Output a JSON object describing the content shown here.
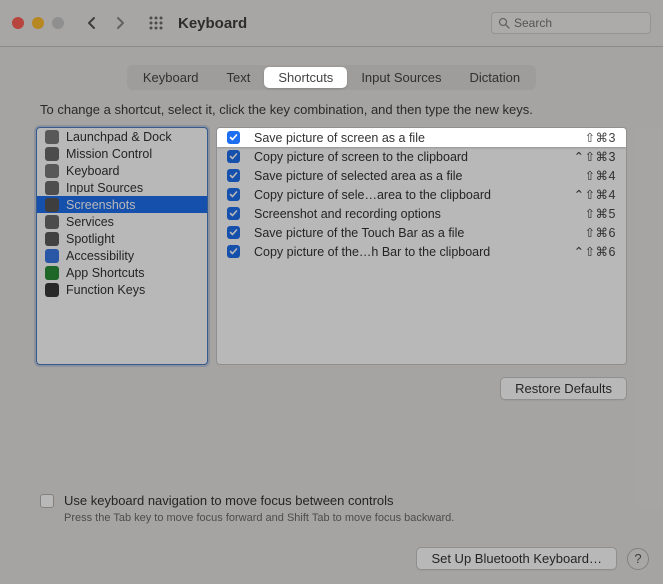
{
  "window": {
    "title": "Keyboard"
  },
  "search": {
    "placeholder": "Search"
  },
  "tabs": [
    {
      "label": "Keyboard"
    },
    {
      "label": "Text"
    },
    {
      "label": "Shortcuts",
      "active": true
    },
    {
      "label": "Input Sources"
    },
    {
      "label": "Dictation"
    }
  ],
  "instruction": "To change a shortcut, select it, click the key combination, and then type the new keys.",
  "categories": [
    {
      "label": "Launchpad & Dock"
    },
    {
      "label": "Mission Control"
    },
    {
      "label": "Keyboard"
    },
    {
      "label": "Input Sources"
    },
    {
      "label": "Screenshots",
      "selected": true
    },
    {
      "label": "Services"
    },
    {
      "label": "Spotlight"
    },
    {
      "label": "Accessibility"
    },
    {
      "label": "App Shortcuts"
    },
    {
      "label": "Function Keys"
    }
  ],
  "shortcuts": [
    {
      "label": "Save picture of screen as a file",
      "keys": "⇧⌘3",
      "selected": true
    },
    {
      "label": "Copy picture of screen to the clipboard",
      "keys": "⌃⇧⌘3"
    },
    {
      "label": "Save picture of selected area as a file",
      "keys": "⇧⌘4"
    },
    {
      "label": "Copy picture of sele…area to the clipboard",
      "keys": "⌃⇧⌘4"
    },
    {
      "label": "Screenshot and recording options",
      "keys": "⇧⌘5"
    },
    {
      "label": "Save picture of the Touch Bar as a file",
      "keys": "⇧⌘6"
    },
    {
      "label": "Copy picture of the…h Bar to the clipboard",
      "keys": "⌃⇧⌘6"
    }
  ],
  "buttons": {
    "restore": "Restore Defaults",
    "bluetooth": "Set Up Bluetooth Keyboard…"
  },
  "kbnav": {
    "label": "Use keyboard navigation to move focus between controls",
    "hint": "Press the Tab key to move focus forward and Shift Tab to move focus backward."
  }
}
